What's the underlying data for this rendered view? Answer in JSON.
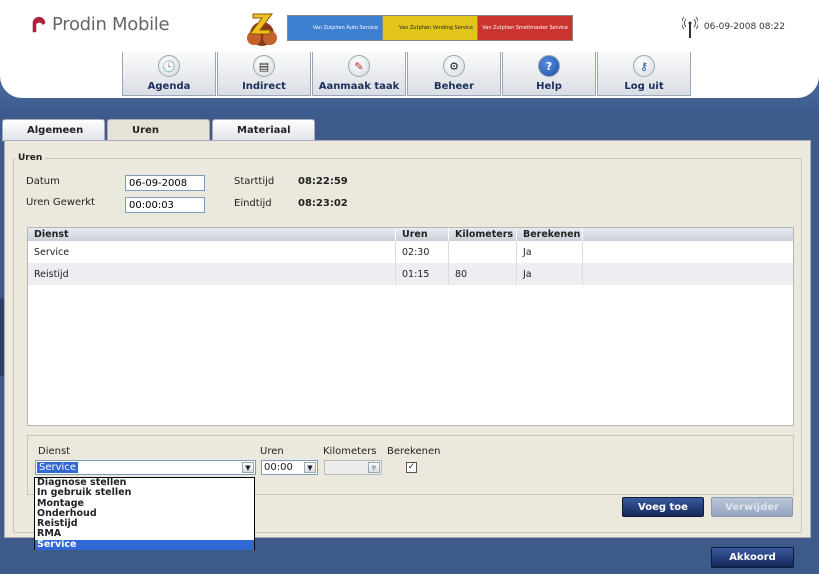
{
  "app": {
    "name": "Prodin Mobile"
  },
  "status": {
    "datetime": "06-09-2008 08:22"
  },
  "banner": {
    "cards": [
      {
        "text": "Van Zutphen Auto Service",
        "color": "#3d7fd1"
      },
      {
        "text": "Van Zutphen Vending Service",
        "color": "#e2c51a"
      },
      {
        "text": "Van Zutphen Smeltmaster Service",
        "color": "#c9342f"
      }
    ]
  },
  "menu": [
    {
      "label": "Agenda",
      "icon": "clock-icon",
      "glyph": "🕓"
    },
    {
      "label": "Indirect",
      "icon": "document-icon",
      "glyph": "▤"
    },
    {
      "label": "Aanmaak taak",
      "icon": "edit-icon",
      "glyph": "✎"
    },
    {
      "label": "Beheer",
      "icon": "gear-icon",
      "glyph": "⚙"
    },
    {
      "label": "Help",
      "icon": "help-icon",
      "glyph": "?"
    },
    {
      "label": "Log uit",
      "icon": "key-icon",
      "glyph": "⚷"
    }
  ],
  "tabs": [
    {
      "label": "Algemeen",
      "active": false
    },
    {
      "label": "Uren",
      "active": true
    },
    {
      "label": "Materiaal",
      "active": false
    }
  ],
  "section": {
    "legend": "Uren"
  },
  "form": {
    "datum_label": "Datum",
    "datum_value": "06-09-2008",
    "uren_gewerkt_label": "Uren Gewerkt",
    "uren_gewerkt_value": "00:00:03",
    "starttijd_label": "Starttijd",
    "starttijd_value": "08:22:59",
    "eindtijd_label": "Eindtijd",
    "eindtijd_value": "08:23:02"
  },
  "grid": {
    "columns": [
      "Dienst",
      "Uren",
      "Kilometers",
      "Berekenen"
    ],
    "rows": [
      {
        "dienst": "Service",
        "uren": "02:30",
        "kilometers": "",
        "berekenen": "Ja"
      },
      {
        "dienst": "Reistijd",
        "uren": "01:15",
        "kilometers": "80",
        "berekenen": "Ja"
      }
    ]
  },
  "edit": {
    "dienst_label": "Dienst",
    "dienst_value": "Service",
    "uren_label": "Uren",
    "uren_value": "00:00",
    "kilometers_label": "Kilometers",
    "kilometers_value": "",
    "berekenen_label": "Berekenen",
    "berekenen_checked": "✓"
  },
  "dropdown": {
    "options": [
      "Diagnose stellen",
      "In gebruik stellen",
      "Montage",
      "Onderhoud",
      "Reistijd",
      "RMA",
      "Service"
    ],
    "selected": "Service"
  },
  "buttons": {
    "voeg_toe": "Voeg toe",
    "verwijder": "Verwijder",
    "akkoord": "Akkoord"
  }
}
